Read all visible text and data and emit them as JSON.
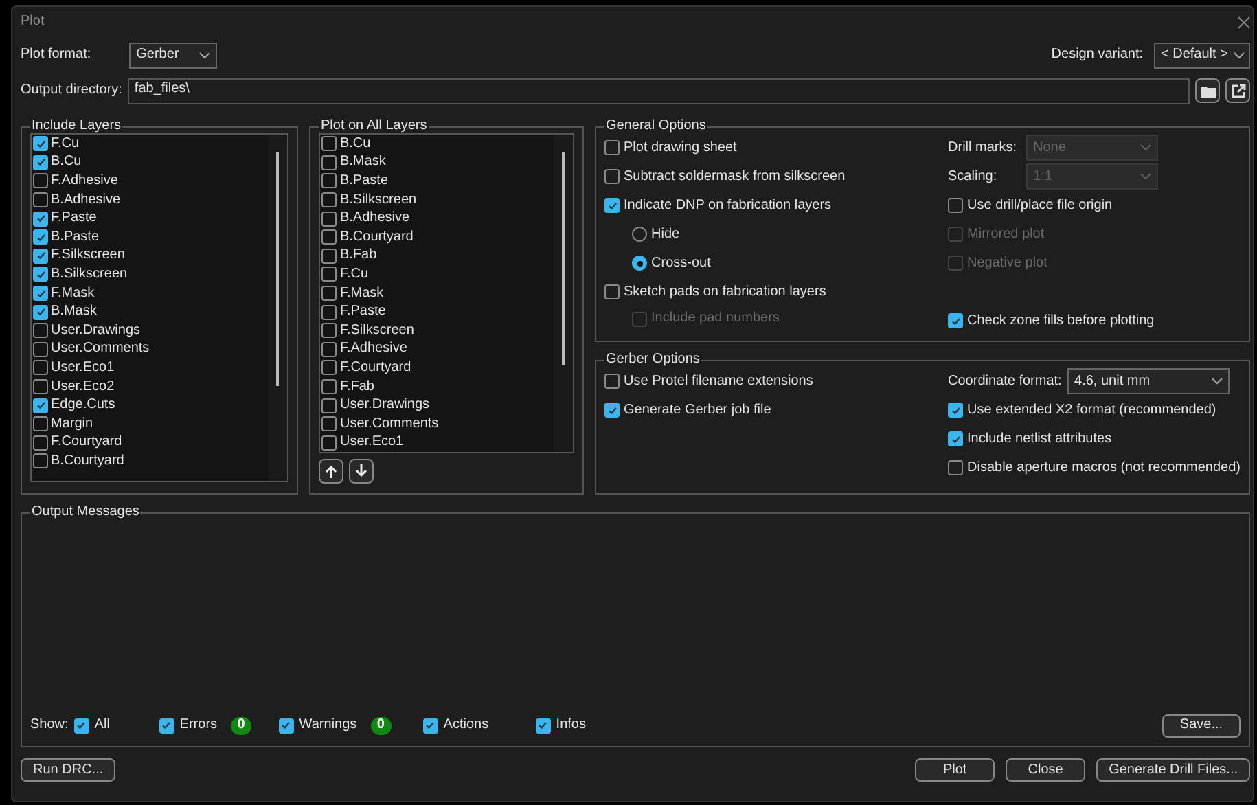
{
  "window": {
    "title": "Plot"
  },
  "plot_format": {
    "label": "Plot format:",
    "value": "Gerber"
  },
  "design_variant": {
    "label": "Design variant:",
    "value": "< Default >"
  },
  "output_directory": {
    "label": "Output directory:",
    "value": "fab_files\\"
  },
  "include_layers": {
    "title": "Include Layers",
    "items": [
      {
        "label": "F.Cu",
        "checked": true
      },
      {
        "label": "B.Cu",
        "checked": true
      },
      {
        "label": "F.Adhesive",
        "checked": false
      },
      {
        "label": "B.Adhesive",
        "checked": false
      },
      {
        "label": "F.Paste",
        "checked": true
      },
      {
        "label": "B.Paste",
        "checked": true
      },
      {
        "label": "F.Silkscreen",
        "checked": true
      },
      {
        "label": "B.Silkscreen",
        "checked": true
      },
      {
        "label": "F.Mask",
        "checked": true
      },
      {
        "label": "B.Mask",
        "checked": true
      },
      {
        "label": "User.Drawings",
        "checked": false
      },
      {
        "label": "User.Comments",
        "checked": false
      },
      {
        "label": "User.Eco1",
        "checked": false
      },
      {
        "label": "User.Eco2",
        "checked": false
      },
      {
        "label": "Edge.Cuts",
        "checked": true
      },
      {
        "label": "Margin",
        "checked": false
      },
      {
        "label": "F.Courtyard",
        "checked": false
      },
      {
        "label": "B.Courtyard",
        "checked": false
      }
    ]
  },
  "plot_on_all_layers": {
    "title": "Plot on All Layers",
    "items": [
      {
        "label": "B.Cu",
        "checked": false
      },
      {
        "label": "B.Mask",
        "checked": false
      },
      {
        "label": "B.Paste",
        "checked": false
      },
      {
        "label": "B.Silkscreen",
        "checked": false
      },
      {
        "label": "B.Adhesive",
        "checked": false
      },
      {
        "label": "B.Courtyard",
        "checked": false
      },
      {
        "label": "B.Fab",
        "checked": false
      },
      {
        "label": "F.Cu",
        "checked": false
      },
      {
        "label": "F.Mask",
        "checked": false
      },
      {
        "label": "F.Paste",
        "checked": false
      },
      {
        "label": "F.Silkscreen",
        "checked": false
      },
      {
        "label": "F.Adhesive",
        "checked": false
      },
      {
        "label": "F.Courtyard",
        "checked": false
      },
      {
        "label": "F.Fab",
        "checked": false
      },
      {
        "label": "User.Drawings",
        "checked": false
      },
      {
        "label": "User.Comments",
        "checked": false
      },
      {
        "label": "User.Eco1",
        "checked": false
      }
    ]
  },
  "general_options": {
    "title": "General Options",
    "left": [
      {
        "kind": "checkbox",
        "label": "Plot drawing sheet",
        "checked": false,
        "disabled": false
      },
      {
        "kind": "checkbox",
        "label": "Subtract soldermask from silkscreen",
        "checked": false,
        "disabled": false
      },
      {
        "kind": "checkbox",
        "label": "Indicate DNP on fabrication layers",
        "checked": true,
        "disabled": false
      },
      {
        "kind": "radio",
        "label": "Hide",
        "selected": false
      },
      {
        "kind": "radio",
        "label": "Cross-out",
        "selected": true
      },
      {
        "kind": "checkbox",
        "label": "Sketch pads on fabrication layers",
        "checked": false,
        "disabled": false
      },
      {
        "kind": "subcheckbox",
        "label": "Include pad numbers",
        "checked": false,
        "disabled": true
      }
    ],
    "right": [
      {
        "kind": "select",
        "label": "Drill marks:",
        "value": "None",
        "disabled": true
      },
      {
        "kind": "select",
        "label": "Scaling:",
        "value": "1:1",
        "disabled": true
      },
      {
        "kind": "checkbox",
        "label": "Use drill/place file origin",
        "checked": false,
        "disabled": false
      },
      {
        "kind": "checkbox",
        "label": "Mirrored plot",
        "checked": false,
        "disabled": true
      },
      {
        "kind": "checkbox",
        "label": "Negative plot",
        "checked": false,
        "disabled": true
      },
      {
        "kind": "checkbox",
        "label": "Check zone fills before plotting",
        "checked": true,
        "disabled": false
      }
    ]
  },
  "gerber_options": {
    "title": "Gerber Options",
    "left": [
      {
        "kind": "checkbox",
        "label": "Use Protel filename extensions",
        "checked": false,
        "disabled": false
      },
      {
        "kind": "checkbox",
        "label": "Generate Gerber job file",
        "checked": true,
        "disabled": false
      }
    ],
    "right": [
      {
        "kind": "select",
        "label": "Coordinate format:",
        "value": "4.6, unit mm",
        "disabled": false
      },
      {
        "kind": "checkbox",
        "label": "Use extended X2 format (recommended)",
        "checked": true,
        "disabled": false
      },
      {
        "kind": "checkbox",
        "label": "Include netlist attributes",
        "checked": true,
        "disabled": false
      },
      {
        "kind": "checkbox",
        "label": "Disable aperture macros (not recommended)",
        "checked": false,
        "disabled": false
      }
    ]
  },
  "output_messages": {
    "title": "Output Messages",
    "show_label": "Show:",
    "filters": [
      {
        "label": "All",
        "checked": true
      },
      {
        "label": "Errors",
        "checked": true,
        "count": "0"
      },
      {
        "label": "Warnings",
        "checked": true,
        "count": "0"
      },
      {
        "label": "Actions",
        "checked": true
      },
      {
        "label": "Infos",
        "checked": true
      }
    ],
    "save_button": "Save..."
  },
  "buttons": [
    {
      "label": "Run DRC...",
      "kind": "left"
    },
    {
      "label": "Plot",
      "kind": "right"
    },
    {
      "label": "Close",
      "kind": "right"
    },
    {
      "label": "Generate Drill Files...",
      "kind": "right"
    }
  ]
}
